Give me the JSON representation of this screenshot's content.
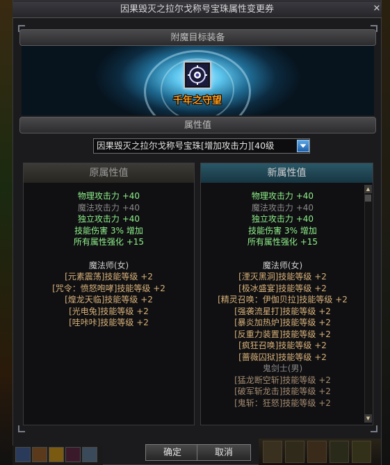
{
  "window": {
    "title": "因果毁灭之拉尔戈称号宝珠属性变更券",
    "close_glyph": "✕"
  },
  "target": {
    "header": "附魔目标装备",
    "item_name": "千年之守望",
    "item_icon": "eye-emblem-icon"
  },
  "attribute": {
    "header": "属性值",
    "selected": "因果毁灭之拉尔戈称号宝珠[增加攻击力][40级"
  },
  "old_panel": {
    "header": "原属性值",
    "stats": [
      {
        "text": "物理攻击力 +40",
        "cls": "g"
      },
      {
        "text": "魔法攻击力 +40",
        "cls": "gr"
      },
      {
        "text": "独立攻击力 +40",
        "cls": "g"
      },
      {
        "text": "技能伤害 3% 增加",
        "cls": "g"
      },
      {
        "text": "所有属性强化 +15",
        "cls": "g"
      }
    ],
    "class_name": "魔法师(女)",
    "skills": [
      {
        "text": "[元素震荡]技能等级 +2",
        "cls": "o"
      },
      {
        "text": "[咒令：愤怒咆哮]技能等级 +2",
        "cls": "o"
      },
      {
        "text": "[煌龙天临]技能等级 +2",
        "cls": "o"
      },
      {
        "text": "[光电兔]技能等级 +2",
        "cls": "o"
      },
      {
        "text": "[哇咔咔]技能等级 +2",
        "cls": "o"
      }
    ]
  },
  "new_panel": {
    "header": "新属性值",
    "stats": [
      {
        "text": "物理攻击力 +40",
        "cls": "g"
      },
      {
        "text": "魔法攻击力 +40",
        "cls": "gr"
      },
      {
        "text": "独立攻击力 +40",
        "cls": "g"
      },
      {
        "text": "技能伤害 3% 增加",
        "cls": "g"
      },
      {
        "text": "所有属性强化 +15",
        "cls": "g"
      }
    ],
    "class_name": "魔法师(女)",
    "skills": [
      {
        "text": "[湮灭黑洞]技能等级 +2",
        "cls": "o"
      },
      {
        "text": "[极冰盛宴]技能等级 +2",
        "cls": "o"
      },
      {
        "text": "[精灵召唤：伊伽贝拉]技能等级 +2",
        "cls": "o"
      },
      {
        "text": "[强袭流星打]技能等级 +2",
        "cls": "o"
      },
      {
        "text": "[暴炎加热炉]技能等级 +2",
        "cls": "o"
      },
      {
        "text": "[反重力装置]技能等级 +2",
        "cls": "o"
      },
      {
        "text": "[疯狂召唤]技能等级 +2",
        "cls": "o"
      },
      {
        "text": "[蔷薇囚狱]技能等级 +2",
        "cls": "o"
      }
    ],
    "class_name_2": "鬼剑士(男)",
    "skills_2": [
      {
        "text": "[猛龙断空斩]技能等级 +2",
        "cls": "og"
      },
      {
        "text": "[破军斩龙击]技能等级 +2",
        "cls": "og"
      },
      {
        "text": "[鬼斩：狂怒]技能等级 +2",
        "cls": "og"
      }
    ]
  },
  "buttons": {
    "ok": "确定",
    "cancel": "取消"
  },
  "colors": {
    "stat_active": "#8ff28b",
    "stat_inactive": "#8a8a8a",
    "skill": "#d9b27a",
    "item_name": "#ff9a1a",
    "new_header": "#2a5867"
  }
}
